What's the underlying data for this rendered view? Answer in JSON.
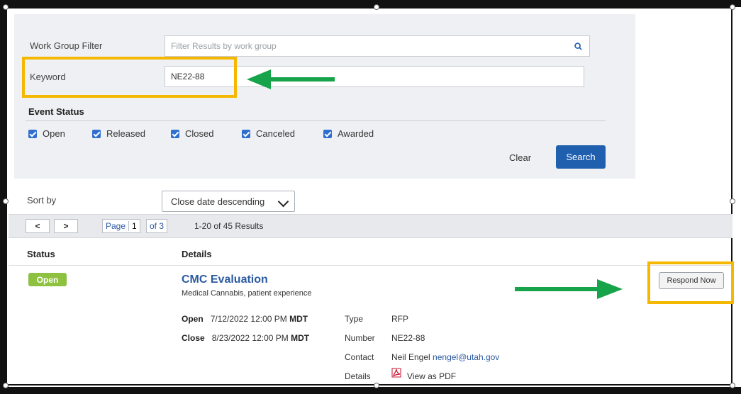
{
  "filters": {
    "work_group_label": "Work Group Filter",
    "work_group_placeholder": "Filter Results by work group",
    "keyword_label": "Keyword",
    "keyword_value": "NE22-88",
    "event_status_title": "Event Status",
    "statuses": [
      {
        "label": "Open",
        "checked": true
      },
      {
        "label": "Released",
        "checked": true
      },
      {
        "label": "Closed",
        "checked": true
      },
      {
        "label": "Canceled",
        "checked": true
      },
      {
        "label": "Awarded",
        "checked": true
      }
    ],
    "clear_label": "Clear",
    "search_label": "Search"
  },
  "sort": {
    "label": "Sort by",
    "selected": "Close date descending"
  },
  "pager": {
    "prev": "<",
    "next": ">",
    "page_label": "Page",
    "page_value": "1",
    "of_label": "of 3",
    "results": "1-20 of 45 Results"
  },
  "table": {
    "status_header": "Status",
    "details_header": "Details"
  },
  "event": {
    "status": "Open",
    "title": "CMC Evaluation",
    "subtitle": "Medical Cannabis, patient experience",
    "open_label": "Open",
    "open_date": "7/12/2022 12:00 PM",
    "open_tz": "MDT",
    "close_label": "Close",
    "close_date": "8/23/2022 12:00 PM",
    "close_tz": "MDT",
    "type_label": "Type",
    "type_value": "RFP",
    "number_label": "Number",
    "number_value": "NE22-88",
    "contact_label": "Contact",
    "contact_name": "Neil Engel",
    "contact_email": "nengel@utah.gov",
    "details_label": "Details",
    "pdf_link": "View as PDF",
    "respond_label": "Respond Now"
  },
  "colors": {
    "highlight": "#f5b800",
    "arrow": "#17a34a",
    "primary_button": "#1f5fae",
    "open_badge": "#8dc13f",
    "link": "#2c5aa0"
  }
}
